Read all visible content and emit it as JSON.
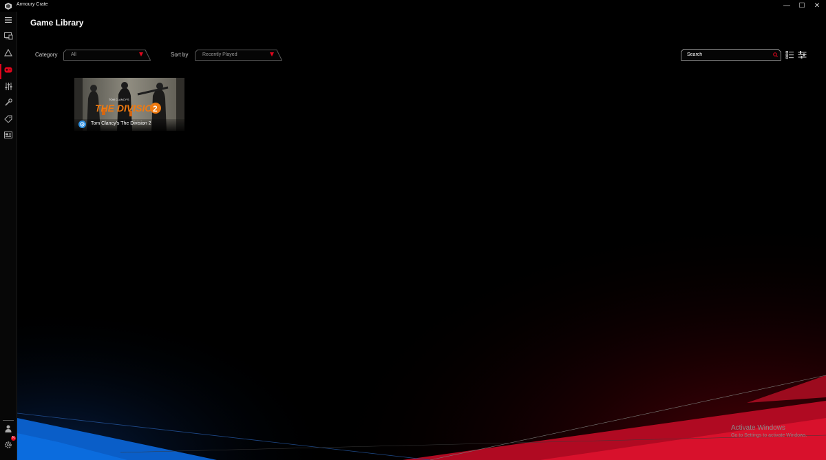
{
  "window": {
    "title": "Armoury Crate",
    "controls": {
      "minimize": "—",
      "maximize": "☐",
      "close": "✕"
    }
  },
  "sidebar": {
    "items": [
      {
        "name": "menu-icon",
        "active": false
      },
      {
        "name": "device-icon",
        "active": false
      },
      {
        "name": "aura-icon",
        "active": false
      },
      {
        "name": "game-library-icon",
        "active": true
      },
      {
        "name": "settings-sliders-icon",
        "active": false
      },
      {
        "name": "tools-icon",
        "active": false
      },
      {
        "name": "deals-tag-icon",
        "active": false
      },
      {
        "name": "news-icon",
        "active": false
      }
    ],
    "bottom": [
      {
        "name": "user-icon"
      },
      {
        "name": "settings-gear-icon",
        "badge": "N"
      }
    ],
    "accent_color": "#e1061d"
  },
  "main": {
    "title": "Game Library",
    "filters": {
      "category_label": "Category",
      "category_value": "All",
      "sortby_label": "Sort by",
      "sortby_value": "Recently Played"
    },
    "search": {
      "placeholder": "Search"
    },
    "view_icons": [
      "list-view-icon",
      "filter-settings-icon"
    ],
    "games": [
      {
        "name": "Tom Clancy's The Division 2",
        "cover_text": "THE DIVISION",
        "cover_number": "2",
        "cover_brand": "TOM CLANCY'S",
        "platform": "uplay"
      }
    ]
  },
  "watermark": {
    "title": "Activate Windows",
    "subtitle": "Go to Settings to activate Windows."
  }
}
